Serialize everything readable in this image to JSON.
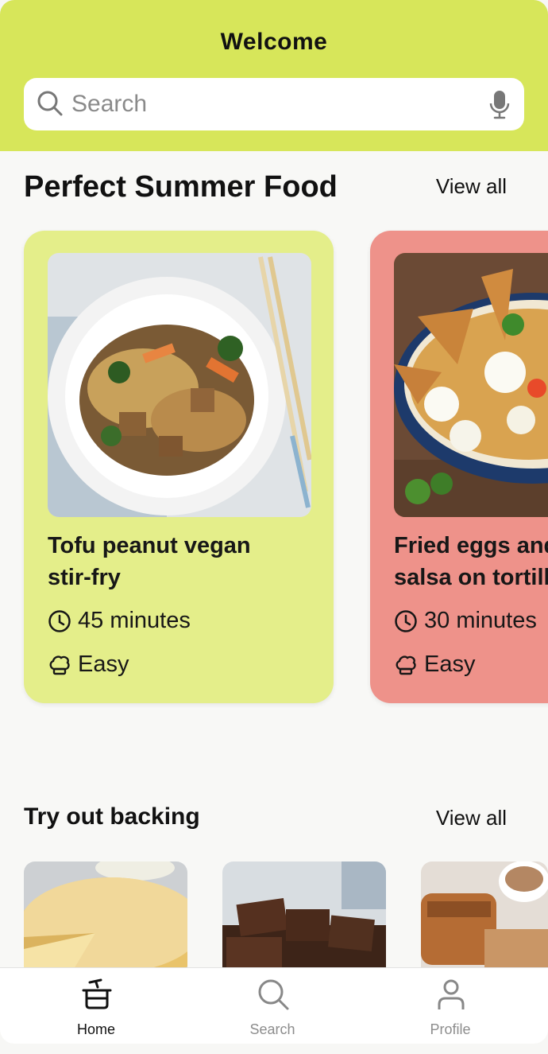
{
  "header": {
    "title": "Welcome"
  },
  "search": {
    "placeholder": "Search",
    "icon": "search-icon",
    "mic_icon": "microphone-icon"
  },
  "featured": {
    "title": "Perfect Summer Food",
    "view_all": "View all",
    "cards": [
      {
        "name": "Tofu peanut vegan\nstir-fry",
        "time": "45 minutes",
        "level": "Easy",
        "color": "#e4ee8a"
      },
      {
        "name": "Fried eggs and\nsalsa on tortilla",
        "time": "30 minutes",
        "level": "Easy",
        "color": "#ee928a"
      }
    ]
  },
  "baking": {
    "title": "Try out backing",
    "view_all": "View all"
  },
  "tabs": [
    {
      "label": "Home",
      "icon": "cooking-pot-icon",
      "active": true
    },
    {
      "label": "Search",
      "icon": "search-icon",
      "active": false
    },
    {
      "label": "Profile",
      "icon": "person-icon",
      "active": false
    }
  ],
  "colors": {
    "header": "#d7e65a",
    "accent_green": "#e4ee8a",
    "accent_red": "#ee928a"
  }
}
